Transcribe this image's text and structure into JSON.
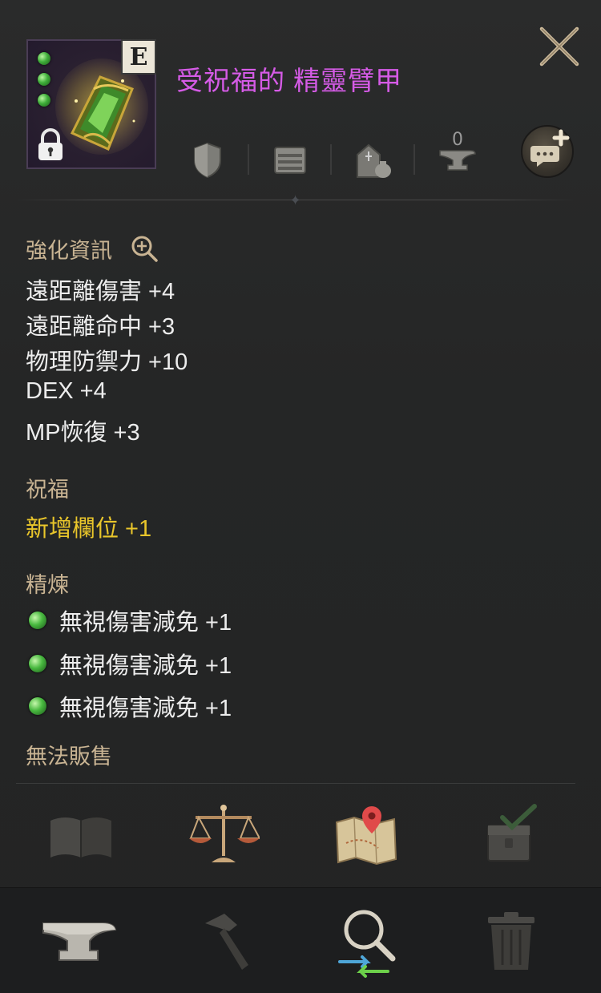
{
  "item": {
    "name": "受祝福的 精靈臂甲",
    "grade": "E",
    "gem_slots": 3,
    "name_color": "#d55be6"
  },
  "header": {
    "anvil_count": "0",
    "icons": [
      "shield-icon",
      "chest-icon",
      "storage-bag-icon",
      "anvil-icon",
      "chat-add-icon",
      "close-icon"
    ]
  },
  "enhance": {
    "title": "強化資訊",
    "stats": [
      "遠距離傷害 +4",
      "遠距離命中 +3",
      "物理防禦力 +10",
      "DEX +4",
      "MP恢復 +3"
    ]
  },
  "blessing": {
    "title": "祝福",
    "line": "新增欄位 +1"
  },
  "refine": {
    "title": "精煉",
    "lines": [
      "無視傷害減免 +1",
      "無視傷害減免 +1",
      "無視傷害減免 +1"
    ]
  },
  "note": "無法販售",
  "actions": [
    "book-icon",
    "scale-icon",
    "map-icon",
    "chest-check-icon"
  ],
  "footer": [
    "anvil-icon",
    "hammer-icon",
    "magnifier-swap-icon",
    "trash-icon"
  ],
  "colors": {
    "section": "#c9b493",
    "blessing": "#e9c62b",
    "stat": "#ededed"
  }
}
